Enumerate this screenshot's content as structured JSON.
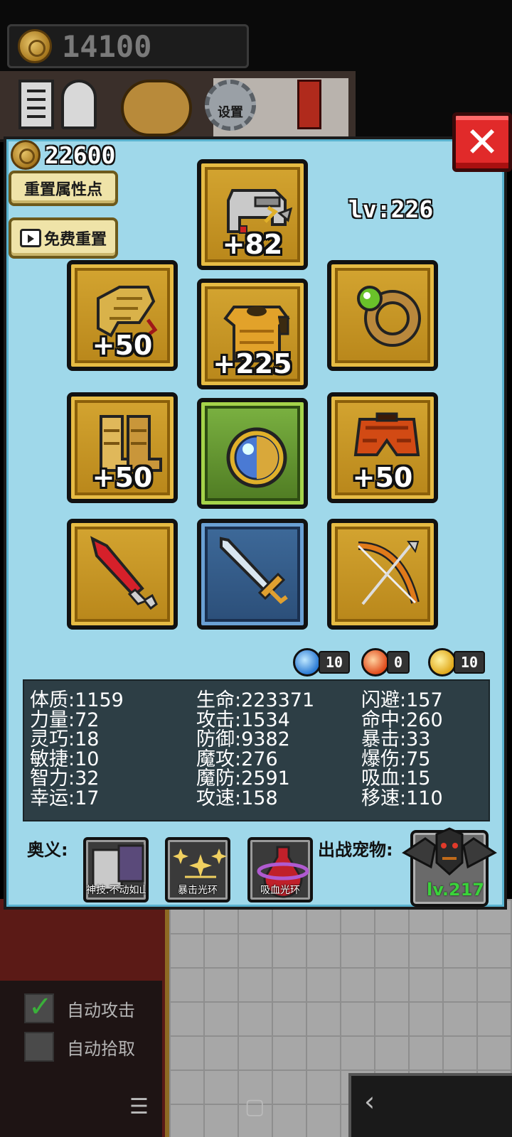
{
  "top_bar": {
    "gold": "14100",
    "settings_label": "设置"
  },
  "panel": {
    "coins": "22600",
    "reset_points_label": "重置属性点",
    "free_reset_label": "免费重置",
    "level": "lv:226",
    "close_label": "✕"
  },
  "equipment": {
    "helmet": {
      "icon": "helmet-icon",
      "bonus": "+82"
    },
    "gloves": {
      "icon": "gloves-icon",
      "bonus": "+50"
    },
    "armor": {
      "icon": "armor-icon",
      "bonus": "+225"
    },
    "ring": {
      "icon": "ring-icon",
      "bonus": ""
    },
    "boots": {
      "icon": "boots-icon",
      "bonus": "+50"
    },
    "amulet": {
      "icon": "amulet-icon",
      "bonus": ""
    },
    "pants": {
      "icon": "pants-icon",
      "bonus": "+50"
    },
    "dagger": {
      "icon": "red-dagger-icon",
      "bonus": ""
    },
    "sword": {
      "icon": "sword-icon",
      "bonus": ""
    },
    "bow": {
      "icon": "bow-icon",
      "bonus": ""
    }
  },
  "gems": {
    "blue": "10",
    "red": "0",
    "yellow": "10"
  },
  "stats": {
    "col1": [
      "体质:1159",
      "力量:72",
      "灵巧:18",
      "敏捷:10",
      "智力:32",
      "幸运:17"
    ],
    "col2": [
      "生命:223371",
      "攻击:1534",
      "防御:9382",
      "魔攻:276",
      "魔防:2591",
      "攻速:158"
    ],
    "col3": [
      "闪避:157",
      "命中:260",
      "暴击:33",
      "爆伤:75",
      "吸血:15",
      "移速:110"
    ]
  },
  "skills": {
    "label": "奥义:",
    "items": [
      "神技.不动如山",
      "暴击光环",
      "吸血光环"
    ]
  },
  "pet": {
    "label": "出战宠物:",
    "level": "lv.217",
    "icon": "bat-demon-icon"
  },
  "controls": {
    "auto_attack": "自动攻击",
    "auto_pickup": "自动拾取"
  },
  "nav": {
    "menu": "☰",
    "home": "▢",
    "back": "‹"
  },
  "colors": {
    "panel_bg": "#9fd8ea",
    "slot_gold": "#d4a531",
    "close_red": "#e12a2a",
    "stats_bg": "#2d3e45",
    "pet_level": "#3ad33a"
  }
}
